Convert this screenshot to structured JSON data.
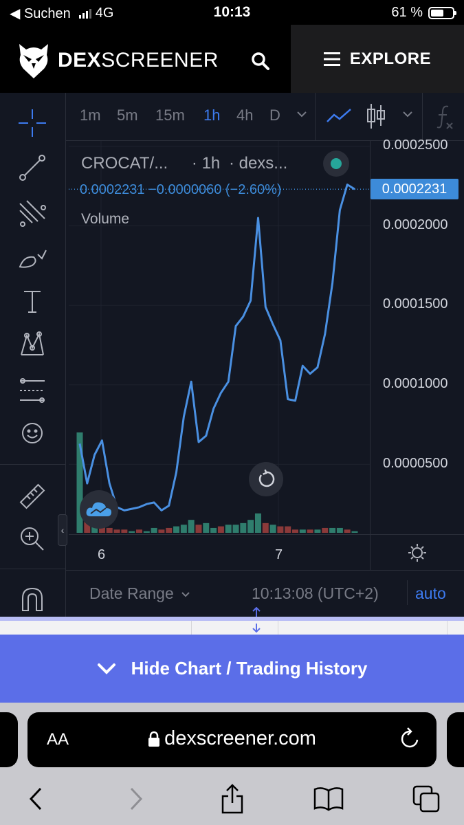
{
  "status_bar": {
    "back_label": "◀ Suchen",
    "network": "4G",
    "time": "10:13",
    "battery_text": "61 %",
    "battery_level": 0.61
  },
  "header": {
    "brand_bold": "DEX",
    "brand_rest": "SCREENER",
    "explore_label": "EXPLORE",
    "search_icon": "search-icon",
    "menu_icon": "hamburger-icon"
  },
  "chart_toolbar": {
    "timeframes": [
      "1m",
      "5m",
      "15m",
      "1h",
      "4h",
      "D"
    ],
    "active_timeframe": "1h"
  },
  "legend": {
    "symbol": "CROCAT/...",
    "interval": "· 1h",
    "source": "· dexs...",
    "price_line": "0.0002231  −0.0000060 (−2.60%)",
    "volume_label": "Volume"
  },
  "price_axis": {
    "labels": [
      "0.0002500",
      "0.0002000",
      "0.0001500",
      "0.0001000",
      "0.0000500"
    ],
    "current_price_tag": "0.0002231"
  },
  "time_axis": {
    "labels": [
      "6",
      "7"
    ]
  },
  "bottom_bar": {
    "date_range_label": "Date Range",
    "clock": "10:13:08 (UTC+2)",
    "auto_label": "auto"
  },
  "hide_chart_label": "Hide Chart / Trading History",
  "safari": {
    "aa_label": "AA",
    "url": "dexscreener.com"
  },
  "colors": {
    "line": "#4a90e2",
    "up_volume": "#2f7d6d",
    "down_volume": "#8b3a3a",
    "accent_blue": "#3d7bf0",
    "hide_chart_bg": "#5b6ee8"
  },
  "chart_data": {
    "type": "line",
    "title": "CROCAT/... · 1h",
    "ylabel": "",
    "xlabel": "",
    "ylim": [
      0,
      0.00025
    ],
    "x_ticks": [
      "6",
      "7"
    ],
    "series": [
      {
        "name": "",
        "values": [
          6.3e-05,
          3.8e-05,
          5.6e-05,
          6.5e-05,
          3.8e-05,
          2.3e-05,
          2.1e-05,
          2.2e-05,
          2.3e-05,
          2.5e-05,
          2.6e-05,
          2.1e-05,
          2.4e-05,
          4.5e-05,
          8e-05,
          0.000102,
          6.4e-05,
          6.8e-05,
          8.5e-05,
          9.5e-05,
          0.000102,
          0.000137,
          0.000143,
          0.000153,
          0.000205,
          0.000149,
          0.000138,
          0.000128,
          9.1e-05,
          9e-05,
          0.000112,
          0.000107,
          0.000111,
          0.000132,
          0.000164,
          0.00021,
          0.000226,
          0.0002231
        ]
      }
    ],
    "volume": [
      {
        "v": 0.62,
        "up": true
      },
      {
        "v": 0.1,
        "up": false
      },
      {
        "v": 0.05,
        "up": true
      },
      {
        "v": 0.04,
        "up": false
      },
      {
        "v": 0.03,
        "up": false
      },
      {
        "v": 0.02,
        "up": false
      },
      {
        "v": 0.02,
        "up": false
      },
      {
        "v": 0.01,
        "up": true
      },
      {
        "v": 0.02,
        "up": false
      },
      {
        "v": 0.01,
        "up": true
      },
      {
        "v": 0.03,
        "up": true
      },
      {
        "v": 0.02,
        "up": false
      },
      {
        "v": 0.03,
        "up": false
      },
      {
        "v": 0.04,
        "up": true
      },
      {
        "v": 0.05,
        "up": true
      },
      {
        "v": 0.08,
        "up": true
      },
      {
        "v": 0.05,
        "up": false
      },
      {
        "v": 0.06,
        "up": true
      },
      {
        "v": 0.03,
        "up": true
      },
      {
        "v": 0.04,
        "up": false
      },
      {
        "v": 0.05,
        "up": true
      },
      {
        "v": 0.05,
        "up": true
      },
      {
        "v": 0.06,
        "up": true
      },
      {
        "v": 0.08,
        "up": true
      },
      {
        "v": 0.12,
        "up": true
      },
      {
        "v": 0.06,
        "up": false
      },
      {
        "v": 0.05,
        "up": true
      },
      {
        "v": 0.04,
        "up": false
      },
      {
        "v": 0.04,
        "up": false
      },
      {
        "v": 0.02,
        "up": false
      },
      {
        "v": 0.02,
        "up": true
      },
      {
        "v": 0.02,
        "up": false
      },
      {
        "v": 0.02,
        "up": true
      },
      {
        "v": 0.03,
        "up": false
      },
      {
        "v": 0.03,
        "up": true
      },
      {
        "v": 0.03,
        "up": true
      },
      {
        "v": 0.02,
        "up": false
      },
      {
        "v": 0.01,
        "up": true
      }
    ]
  }
}
